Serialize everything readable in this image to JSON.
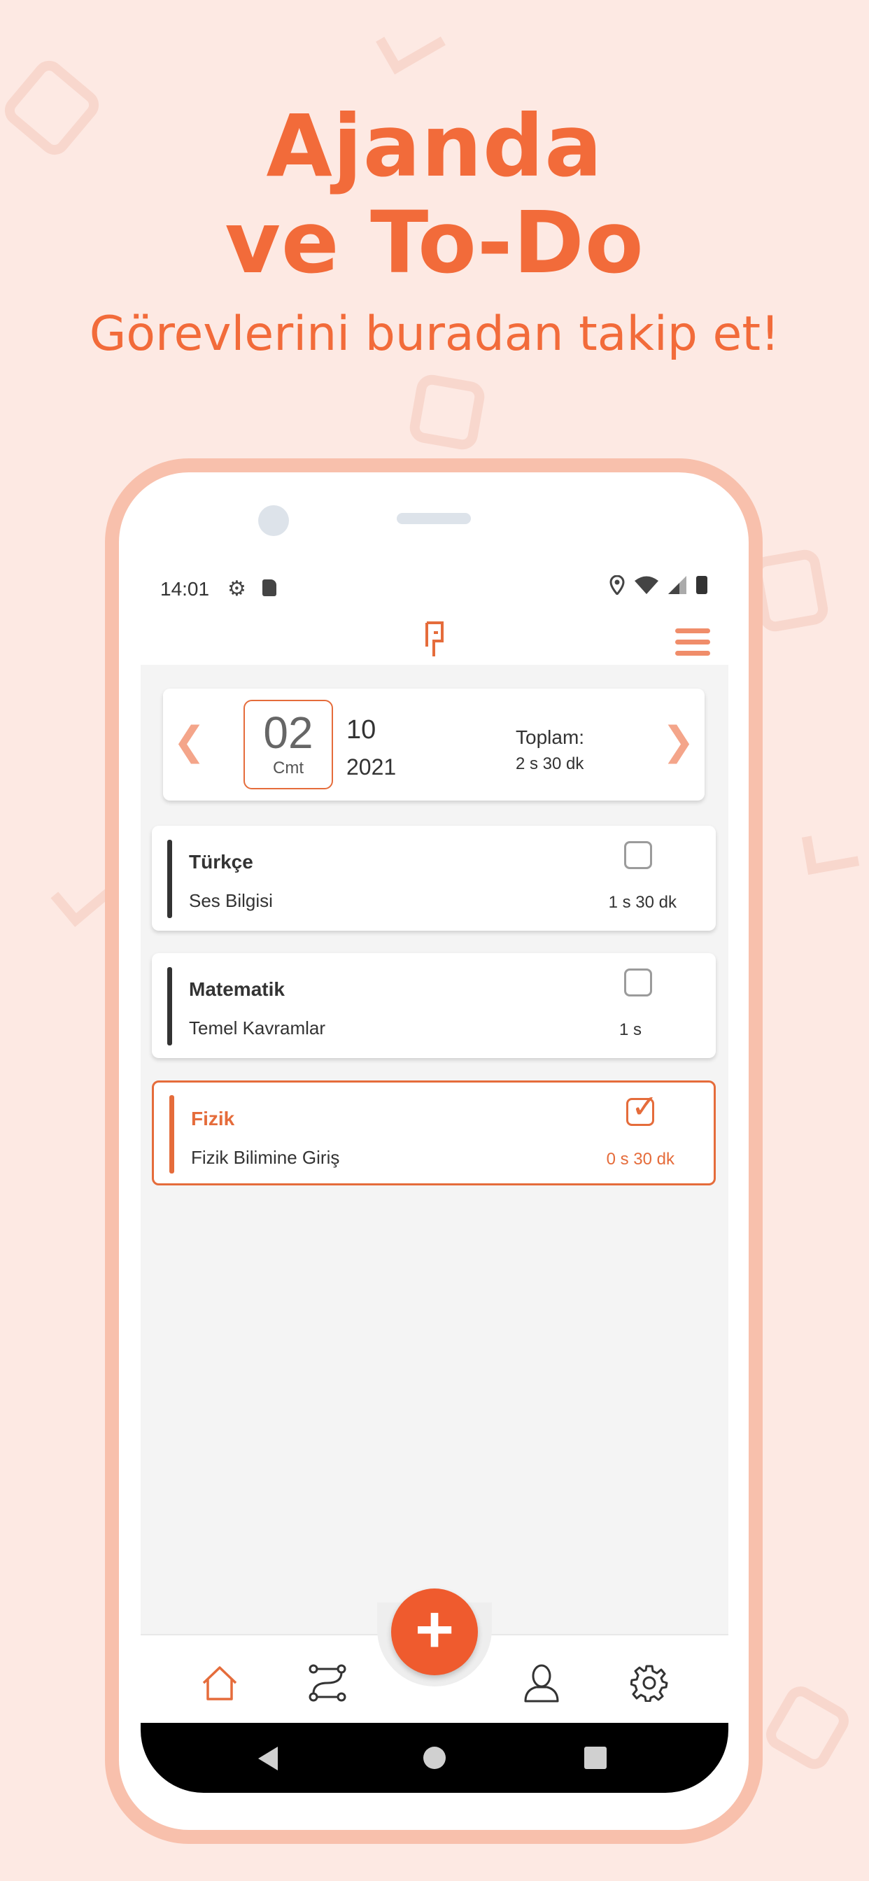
{
  "promo": {
    "headline_line1": "Ajanda",
    "headline_line2": "ve To-Do",
    "subtitle": "Görevlerini buradan takip et!"
  },
  "status_bar": {
    "time": "14:01",
    "icons": [
      "gear-icon",
      "sd-card-icon",
      "location-icon",
      "wifi-icon",
      "signal-icon",
      "battery-icon"
    ]
  },
  "app_bar": {
    "logo": "app-logo",
    "menu_icon": "hamburger-menu-icon"
  },
  "date_selector": {
    "prev_icon": "chevron-left-icon",
    "next_icon": "chevron-right-icon",
    "day": "02",
    "weekday": "Cmt",
    "month": "10",
    "year": "2021",
    "total_label": "Toplam:",
    "total_value": "2 s 30 dk"
  },
  "tasks": [
    {
      "subject": "Türkçe",
      "topic": "Ses Bilgisi",
      "duration": "1 s 30 dk",
      "completed": false
    },
    {
      "subject": "Matematik",
      "topic": "Temel Kavramlar",
      "duration": "1 s",
      "completed": false
    },
    {
      "subject": "Fizik",
      "topic": "Fizik Bilimine Giriş",
      "duration": "0 s 30 dk",
      "completed": true
    }
  ],
  "bottom_nav": {
    "items": [
      "home-icon",
      "route-icon",
      "add-icon",
      "profile-icon",
      "settings-icon"
    ],
    "fab_label": "+"
  },
  "colors": {
    "accent": "#f26b3a",
    "background": "#fde9e3",
    "phone_frame": "#f8c0ac"
  }
}
